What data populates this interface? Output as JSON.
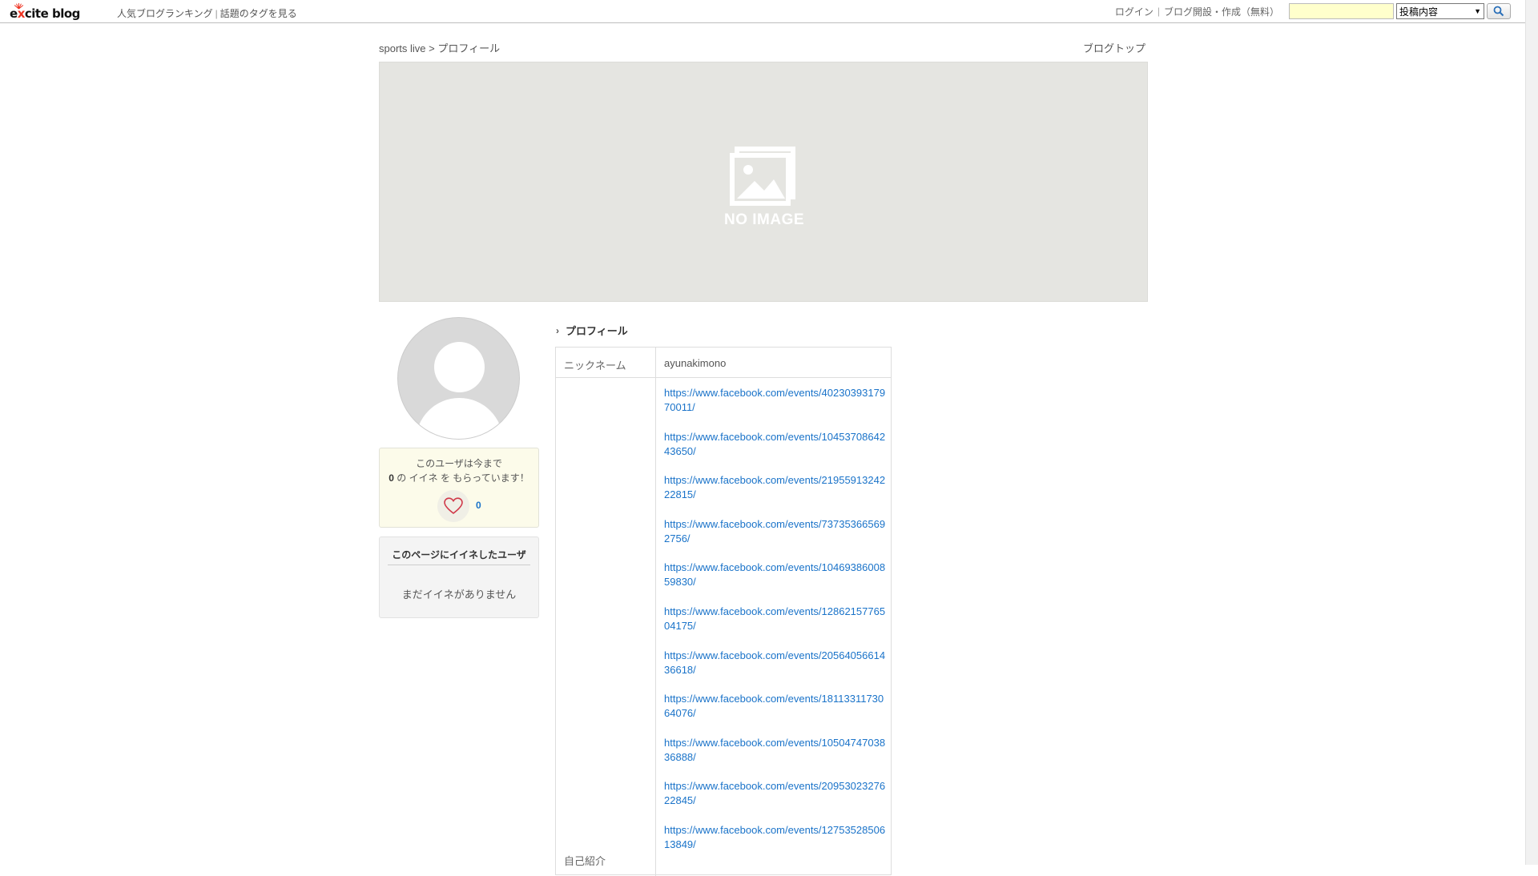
{
  "header": {
    "logo_prefix": "e",
    "logo_x": "x",
    "logo_rest": "cite blog",
    "nav": [
      "人気ブログランキング",
      "話題のタグを見る"
    ],
    "login": "ログイン",
    "signup": "ブログ開設・作成（無料）",
    "search_value": "",
    "search_select": "投稿内容"
  },
  "breadcrumb": {
    "blog": "sports live",
    "sep": ">",
    "current": "プロフィール"
  },
  "blog_top": "ブログトップ",
  "hero": {
    "no_image": "NO IMAGE"
  },
  "iine": {
    "line1": "このユーザは今まで",
    "count": "0",
    "line2": " の イイネ を もらっています！",
    "button_count": "0"
  },
  "liked": {
    "title": "このページにイイネしたユーザ",
    "empty": "まだイイネがありません"
  },
  "profile": {
    "heading": "プロフィール",
    "nickname_label": "ニックネーム",
    "nickname": "ayunakimono",
    "intro_label": "自己紹介",
    "links": [
      "https://www.facebook.com/events/4023039317970011/",
      "https://www.facebook.com/events/1045370864243650/",
      "https://www.facebook.com/events/2195591324222815/",
      "https://www.facebook.com/events/737353665692756/",
      "https://www.facebook.com/events/1046938600859830/",
      "https://www.facebook.com/events/1286215776504175/",
      "https://www.facebook.com/events/2056405661436618/",
      "https://www.facebook.com/events/1811331173064076/",
      "https://www.facebook.com/events/1050474703836888/",
      "https://www.facebook.com/events/2095302327622845/",
      "https://www.facebook.com/events/1275352850613849/"
    ]
  },
  "colors": {
    "link": "#1a73c9",
    "search_bg": "#ffffcc",
    "iine_bg": "#fcfbea"
  }
}
